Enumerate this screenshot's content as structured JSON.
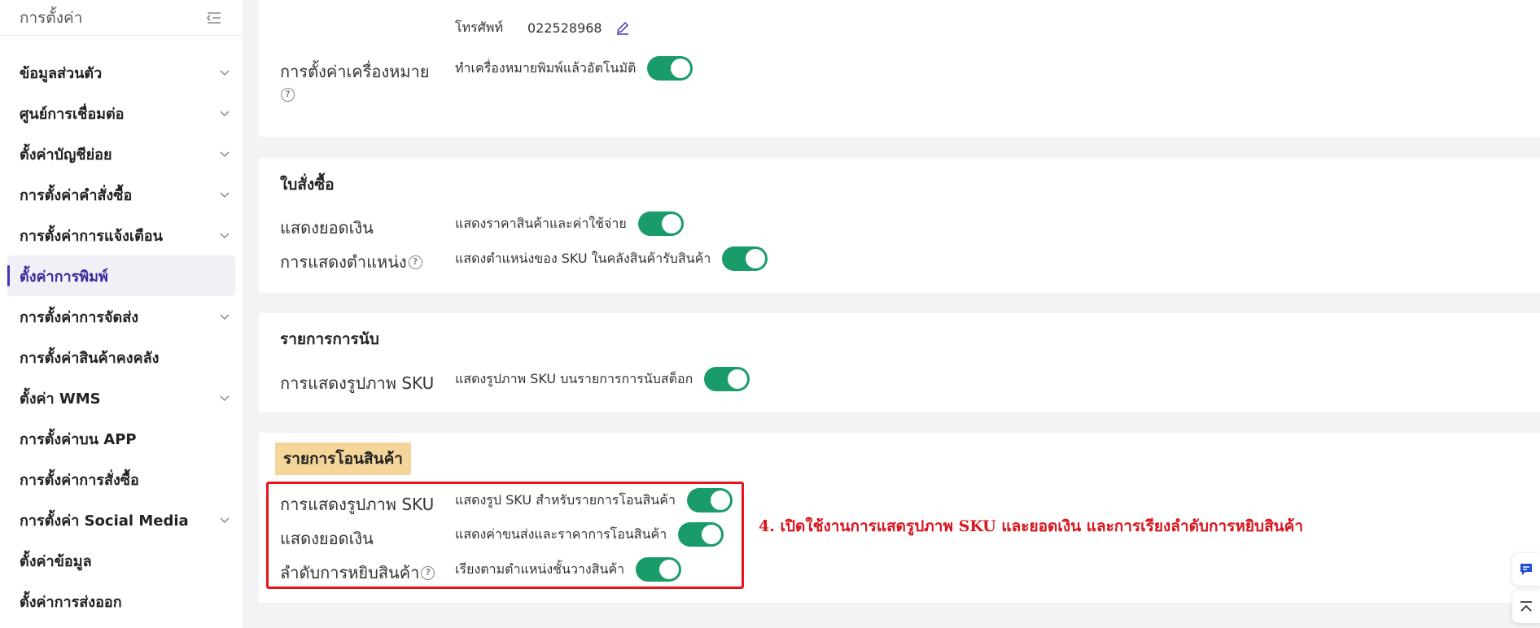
{
  "sidebar": {
    "title": "การตั้งค่า",
    "items": [
      {
        "label": "ข้อมูลส่วนตัว",
        "chevron": true
      },
      {
        "label": "ศูนย์การเชื่อมต่อ",
        "chevron": true
      },
      {
        "label": "ตั้งค่าบัญชีย่อย",
        "chevron": true
      },
      {
        "label": "การตั้งค่าคำสั่งซื้อ",
        "chevron": true
      },
      {
        "label": "การตั้งค่าการแจ้งเตือน",
        "chevron": true
      },
      {
        "label": "ตั้งค่าการพิมพ์",
        "chevron": false,
        "active": true
      },
      {
        "label": "การตั้งค่าการจัดส่ง",
        "chevron": true
      },
      {
        "label": "การตั้งค่าสินค้าคงคลัง",
        "chevron": false
      },
      {
        "label": "ตั้งค่า WMS",
        "chevron": true
      },
      {
        "label": "การตั้งค่าบน APP",
        "chevron": false
      },
      {
        "label": "การตั้งค่าการสั่งซื้อ",
        "chevron": false
      },
      {
        "label": "การตั้งค่า Social Media",
        "chevron": true
      },
      {
        "label": "ตั้งค่าข้อมูล",
        "chevron": false
      },
      {
        "label": "ตั้งค่าการส่งออก",
        "chevron": false
      }
    ]
  },
  "card1": {
    "phone_label": "โทรศัพท์",
    "phone_value": "022528968",
    "printer_label": "การตั้งค่าเครื่องหมาย",
    "printer_text": "ทำเครื่องหมายพิมพ์แล้วอัตโนมัติ"
  },
  "card2": {
    "title": "ใบสั่งซื้อ",
    "row1_label": "แสดงยอดเงิน",
    "row1_text": "แสดงราคาสินค้าและค่าใช้จ่าย",
    "row2_label": "การแสดงตำแหน่ง",
    "row2_text": "แสดงตำแหน่งของ SKU ในคลังสินค้ารับสินค้า"
  },
  "card3": {
    "title": "รายการการนับ",
    "row1_label": "การแสดงรูปภาพ SKU",
    "row1_text": "แสดงรูปภาพ SKU บนรายการการนับสต็อก"
  },
  "card4": {
    "title": "รายการโอนสินค้า",
    "row1_label": "การแสดงรูปภาพ SKU",
    "row1_text": "แสดงรูป SKU สำหรับรายการโอนสินค้า",
    "row2_label": "แสดงยอดเงิน",
    "row2_text": "แสดงค่าขนส่งและราคาการโอนสินค้า",
    "row3_label": "ลำดับการหยิบสินค้า",
    "row3_text": "เรียงตามตำแหน่งชั้นวางสินค้า"
  },
  "annotation": "4. เปิดใช้งานการแสดรูปภาพ SKU และยอดเงิน และการเรียงลำดับการหยิบสินค้า",
  "help_glyph": "?",
  "colors": {
    "toggle_on": "#1a9b6a",
    "accent": "#4a31b8",
    "annotation": "#d9141c",
    "highlight": "#f5d69a"
  }
}
